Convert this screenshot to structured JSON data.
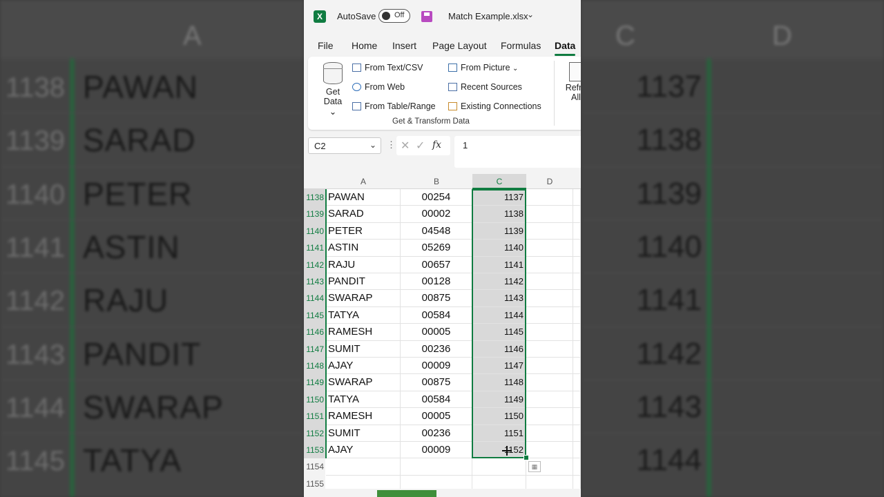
{
  "zoom_left": {
    "col_header": "A",
    "rows": [
      {
        "num": "1138",
        "name": "PAWAN"
      },
      {
        "num": "1139",
        "name": "SARAD"
      },
      {
        "num": "1140",
        "name": "PETER"
      },
      {
        "num": "1141",
        "name": "ASTIN"
      },
      {
        "num": "1142",
        "name": "RAJU"
      },
      {
        "num": "1143",
        "name": "PANDIT"
      },
      {
        "num": "1144",
        "name": "SWARAP"
      },
      {
        "num": "1145",
        "name": "TATYA"
      }
    ]
  },
  "zoom_right": {
    "col_header_c": "C",
    "col_header_d": "D",
    "values": [
      "1137",
      "1138",
      "1139",
      "1140",
      "1141",
      "1142",
      "1143",
      "1144"
    ]
  },
  "titlebar": {
    "app_icon": "X",
    "autosave_label": "AutoSave",
    "autosave_state": "Off",
    "filename": "Match Example.xlsx",
    "caret": "⌄"
  },
  "tabs": [
    "File",
    "Home",
    "Insert",
    "Page Layout",
    "Formulas",
    "Data"
  ],
  "ribbon": {
    "get_data_line1": "Get",
    "get_data_line2": "Data",
    "from_text_csv": "From Text/CSV",
    "from_web": "From Web",
    "from_table_range": "From Table/Range",
    "from_picture": "From Picture",
    "recent_sources": "Recent Sources",
    "existing_connections": "Existing Connections",
    "group_label": "Get & Transform Data",
    "refresh_line1": "Refre",
    "refresh_line2": "All"
  },
  "formula_bar": {
    "name_box": "C2",
    "formula": "1",
    "fx": "fx"
  },
  "grid": {
    "columns": [
      "A",
      "B",
      "C",
      "D"
    ],
    "rows": [
      {
        "num": "1138",
        "a": "PAWAN",
        "b": "00254",
        "c": "1137"
      },
      {
        "num": "1139",
        "a": "SARAD",
        "b": "00002",
        "c": "1138"
      },
      {
        "num": "1140",
        "a": "PETER",
        "b": "04548",
        "c": "1139"
      },
      {
        "num": "1141",
        "a": "ASTIN",
        "b": "05269",
        "c": "1140"
      },
      {
        "num": "1142",
        "a": "RAJU",
        "b": "00657",
        "c": "1141"
      },
      {
        "num": "1143",
        "a": "PANDIT",
        "b": "00128",
        "c": "1142"
      },
      {
        "num": "1144",
        "a": "SWARAP",
        "b": "00875",
        "c": "1143"
      },
      {
        "num": "1145",
        "a": "TATYA",
        "b": "00584",
        "c": "1144"
      },
      {
        "num": "1146",
        "a": "RAMESH",
        "b": "00005",
        "c": "1145"
      },
      {
        "num": "1147",
        "a": "SUMIT",
        "b": "00236",
        "c": "1146"
      },
      {
        "num": "1148",
        "a": "AJAY",
        "b": "00009",
        "c": "1147"
      },
      {
        "num": "1149",
        "a": "SWARAP",
        "b": "00875",
        "c": "1148"
      },
      {
        "num": "1150",
        "a": "TATYA",
        "b": "00584",
        "c": "1149"
      },
      {
        "num": "1151",
        "a": "RAMESH",
        "b": "00005",
        "c": "1150"
      },
      {
        "num": "1152",
        "a": "SUMIT",
        "b": "00236",
        "c": "1151"
      },
      {
        "num": "1153",
        "a": "AJAY",
        "b": "00009",
        "c": "1152"
      },
      {
        "num": "1154",
        "a": "",
        "b": "",
        "c": ""
      },
      {
        "num": "1155",
        "a": "",
        "b": "",
        "c": ""
      }
    ]
  },
  "colors": {
    "excel_green": "#107c41",
    "selection_fill": "#d9d9d9",
    "save_icon": "#b84ac0"
  }
}
